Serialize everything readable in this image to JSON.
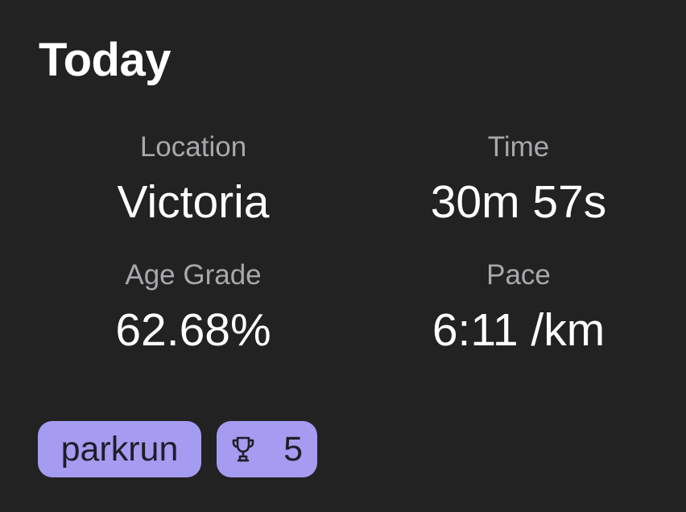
{
  "card": {
    "title": "Today"
  },
  "stats": {
    "location": {
      "label": "Location",
      "value": "Victoria"
    },
    "time": {
      "label": "Time",
      "value": "30m 57s"
    },
    "age_grade": {
      "label": "Age Grade",
      "value": "62.68%"
    },
    "pace": {
      "label": "Pace",
      "value": "6:11 /km"
    }
  },
  "chips": {
    "event": {
      "label": "parkrun"
    },
    "trophy": {
      "icon": "trophy-icon",
      "count": "5"
    }
  },
  "colors": {
    "background": "#222222",
    "text_primary": "#ffffff",
    "text_secondary": "#a8a8ad",
    "chip_background": "#a59bf0",
    "chip_text": "#1e1e28"
  }
}
